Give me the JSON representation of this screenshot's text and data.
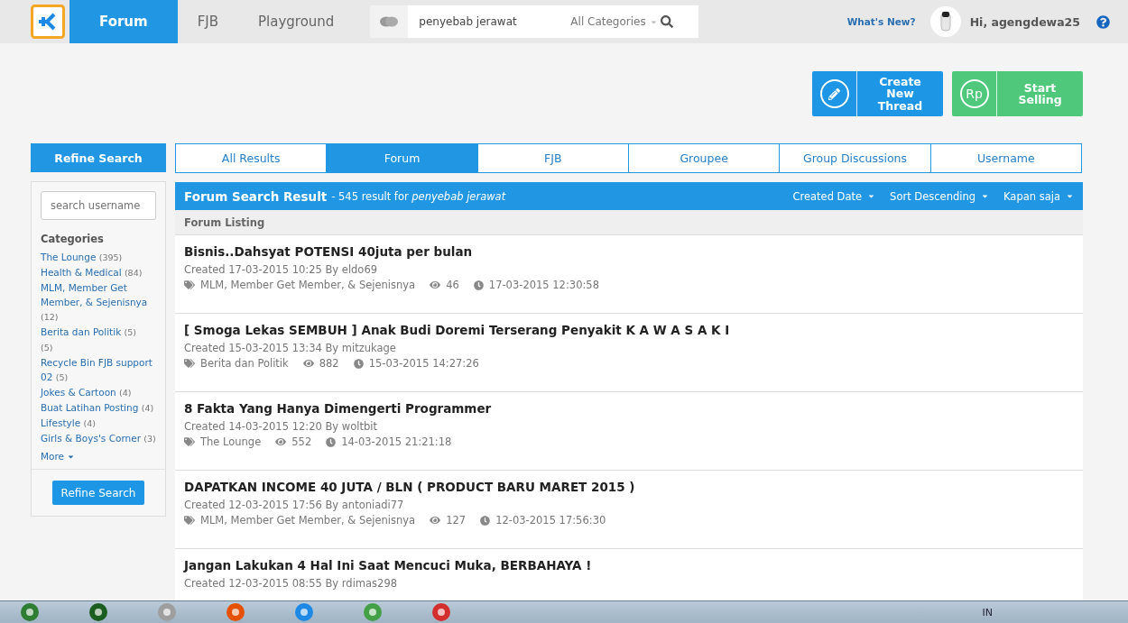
{
  "topbar": {
    "nav": [
      {
        "label": "Forum",
        "selected": true
      },
      {
        "label": "FJB",
        "selected": false
      },
      {
        "label": "Playground",
        "selected": false
      }
    ],
    "search": {
      "value": "penyebab jerawat",
      "category": "All Categories"
    },
    "whats_new": "What's New?",
    "greeting": "Hi, agengdewa25"
  },
  "actions": [
    {
      "kind": "thread",
      "label": "Create New Thread",
      "color": "#1e96e6"
    },
    {
      "kind": "sell",
      "label": "Start Selling",
      "icon_text": "Rp",
      "color": "#4fc87c"
    }
  ],
  "sidebar": {
    "title": "Refine Search",
    "username_placeholder": "search username",
    "categories_title": "Categories",
    "categories": [
      {
        "name": "The Lounge",
        "count": "(395)"
      },
      {
        "name": "Health & Medical",
        "count": "(84)"
      },
      {
        "name": "MLM, Member Get Member, & Sejenisnya",
        "count": "(12)"
      },
      {
        "name": "Berita dan Politik",
        "count": "(5)"
      },
      {
        "count": "(5)"
      },
      {
        "name": "Recycle Bin FJB support 02",
        "count": "(5)"
      },
      {
        "name": "Jokes & Cartoon",
        "count": "(4)"
      },
      {
        "name": "Buat Latihan Posting",
        "count": "(4)"
      },
      {
        "name": "Lifestyle",
        "count": "(4)"
      },
      {
        "name": "Girls & Boys's Corner",
        "count": "(3)"
      }
    ],
    "more": "More",
    "button": "Refine Search"
  },
  "tabs": [
    {
      "label": "All Results",
      "selected": false
    },
    {
      "label": "Forum",
      "selected": true
    },
    {
      "label": "FJB",
      "selected": false
    },
    {
      "label": "Groupee",
      "selected": false
    },
    {
      "label": "Group Discussions",
      "selected": false
    },
    {
      "label": "Username",
      "selected": false
    }
  ],
  "results": {
    "title": "Forum Search Result",
    "summary": "- 545 result for *penyebab jerawat*",
    "sorts": [
      "Created Date",
      "Sort Descending",
      "Kapan saja"
    ],
    "listing": "Forum Listing",
    "threads": [
      {
        "title": "Bisnis..Dahsyat POTENSI 40juta per bulan",
        "created": "Created 17-03-2015 10:25 By eldo69",
        "category": "MLM, Member Get Member, & Sejenisnya",
        "views": "46",
        "last": "17-03-2015 12:30:58"
      },
      {
        "title": "[ Smoga Lekas SEMBUH ] Anak Budi Doremi Terserang Penyakit K A W A S A K I",
        "created": "Created 15-03-2015 13:34 By mitzukage",
        "category": "Berita dan Politik",
        "views": "882",
        "last": "15-03-2015 14:27:26"
      },
      {
        "title": "8 Fakta Yang Hanya Dimengerti Programmer",
        "created": "Created 14-03-2015 12:20 By woltbit",
        "category": "The Lounge",
        "views": "552",
        "last": "14-03-2015 21:21:18"
      },
      {
        "title": "DAPATKAN INCOME 40 JUTA / BLN ( PRODUCT BARU MARET 2015 )",
        "created": "Created 12-03-2015 17:56 By antoniadi77",
        "category": "MLM, Member Get Member, & Sejenisnya",
        "views": "127",
        "last": "12-03-2015 17:56:30"
      },
      {
        "title": "Jangan Lakukan 4 Hal Ini Saat Mencuci Muka, BERBAHAYA !",
        "created": "Created 12-03-2015 08:55 By rdimas298"
      }
    ]
  },
  "taskbar": {
    "language": "IN"
  }
}
